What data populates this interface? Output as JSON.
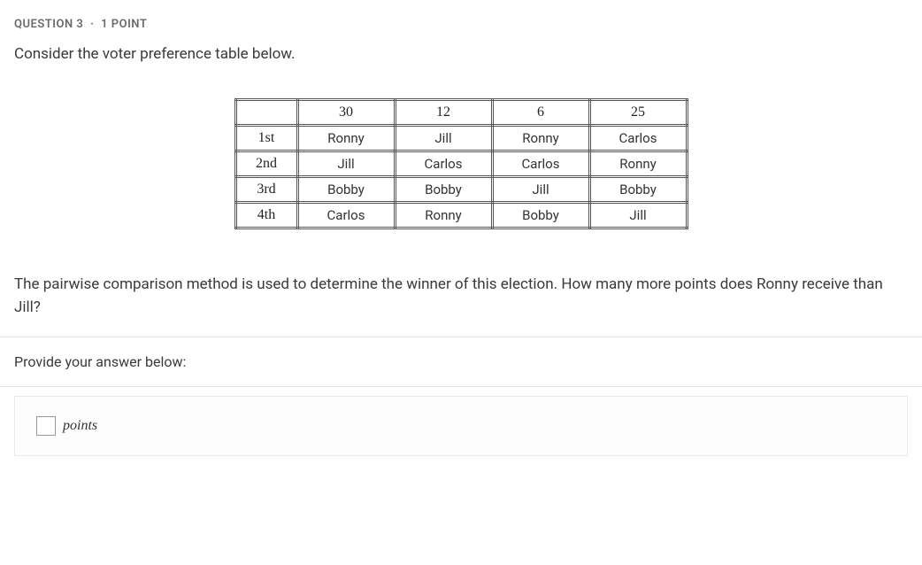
{
  "header": {
    "question_label": "QUESTION 3",
    "separator": "·",
    "points_label": "1 POINT"
  },
  "intro_text": "Consider the voter preference table below.",
  "table": {
    "column_headers": [
      "",
      "30",
      "12",
      "6",
      "25"
    ],
    "rows": [
      {
        "label": "1st",
        "cells": [
          "Ronny",
          "Jill",
          "Ronny",
          "Carlos"
        ]
      },
      {
        "label": "2nd",
        "cells": [
          "Jill",
          "Carlos",
          "Carlos",
          "Ronny"
        ]
      },
      {
        "label": "3rd",
        "cells": [
          "Bobby",
          "Bobby",
          "Jill",
          "Bobby"
        ]
      },
      {
        "label": "4th",
        "cells": [
          "Carlos",
          "Ronny",
          "Bobby",
          "Jill"
        ]
      }
    ]
  },
  "question_text": "The pairwise comparison method is used to determine the winner of this election. How many more points does Ronny receive than Jill?",
  "provide_label": "Provide your answer below:",
  "answer": {
    "value": "",
    "unit": "points"
  }
}
